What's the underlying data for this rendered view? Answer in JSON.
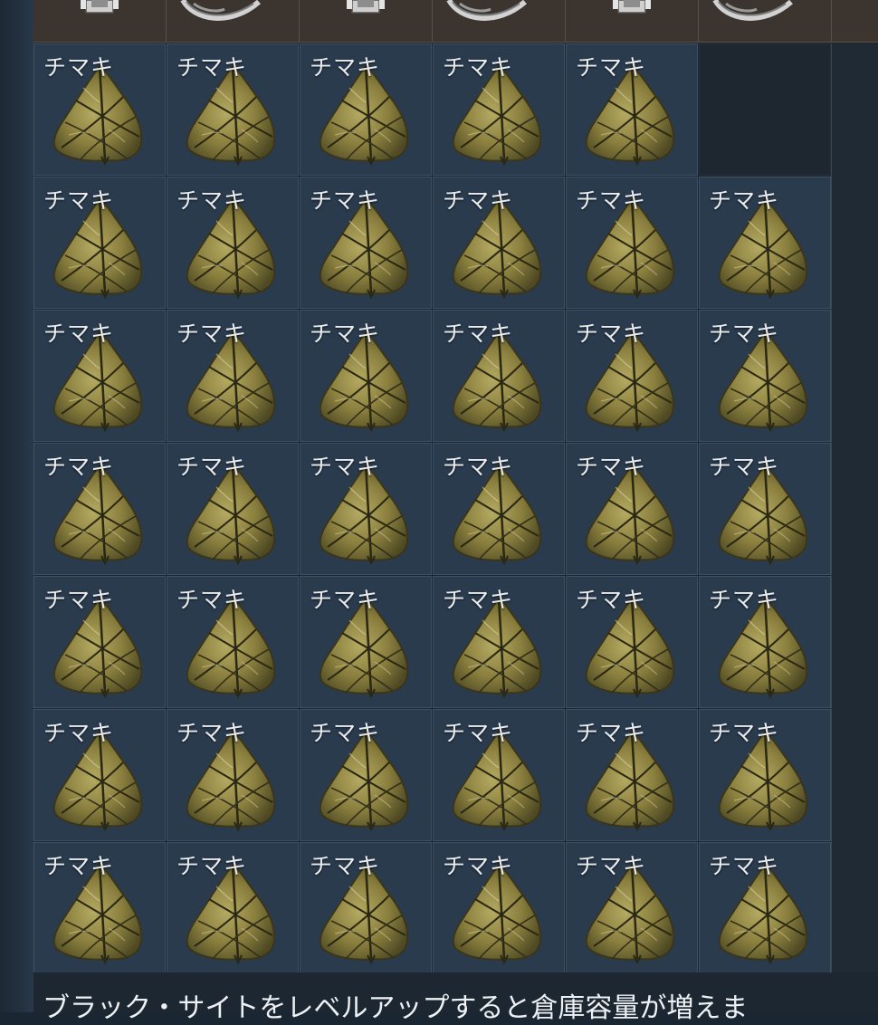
{
  "inventory": {
    "item_label": "チマキ",
    "item_icon": "chimaki-rice-dumpling-icon",
    "top_row_icons": [
      "armor-icon",
      "curved-blade-icon",
      "armor-icon",
      "curved-blade-icon",
      "armor-icon",
      "curved-blade-icon"
    ],
    "rows": [
      [
        "チマキ",
        "チマキ",
        "チマキ",
        "チマキ",
        "チマキ",
        ""
      ],
      [
        "チマキ",
        "チマキ",
        "チマキ",
        "チマキ",
        "チマキ",
        "チマキ"
      ],
      [
        "チマキ",
        "チマキ",
        "チマキ",
        "チマキ",
        "チマキ",
        "チマキ"
      ],
      [
        "チマキ",
        "チマキ",
        "チマキ",
        "チマキ",
        "チマキ",
        "チマキ"
      ],
      [
        "チマキ",
        "チマキ",
        "チマキ",
        "チマキ",
        "チマキ",
        "チマキ"
      ],
      [
        "チマキ",
        "チマキ",
        "チマキ",
        "チマキ",
        "チマキ",
        "チマキ"
      ],
      [
        "チマキ",
        "チマキ",
        "チマキ",
        "チマキ",
        "チマキ",
        "チマキ"
      ]
    ]
  },
  "footer": {
    "message": "ブラック・サイトをレベルアップすると倉庫容量が増えま"
  },
  "colors": {
    "cell_bg": "#2a3b4e",
    "cell_border": "#3e5063",
    "top_strip": "#3c342f",
    "chimaki_leaf": "#8a8240"
  }
}
